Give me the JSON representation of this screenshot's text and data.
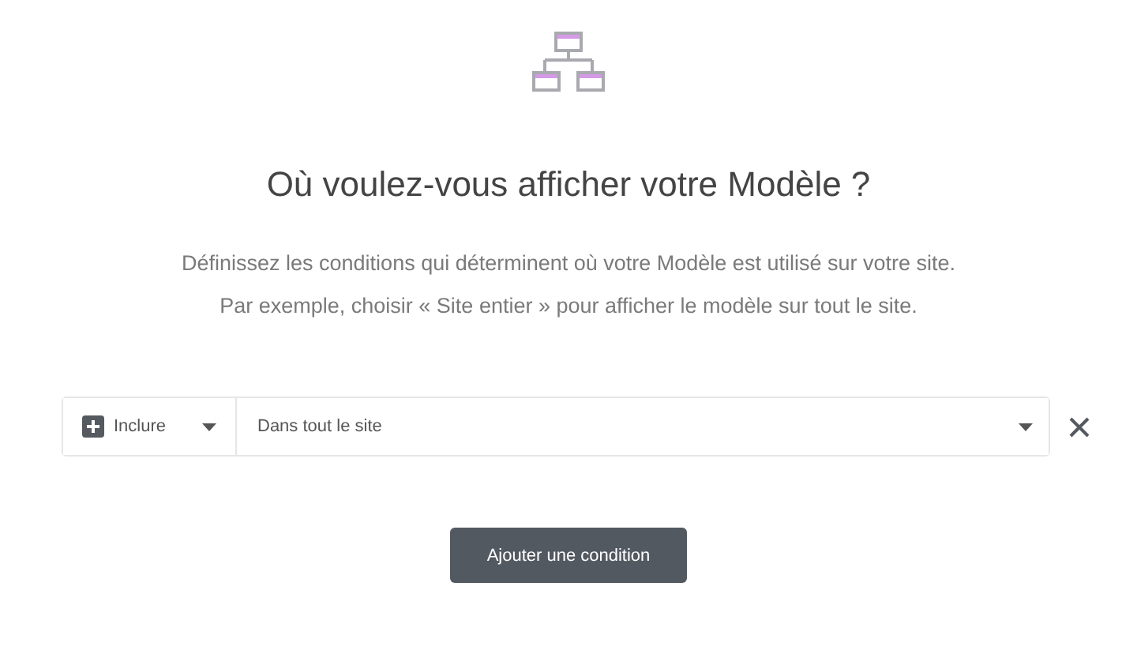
{
  "title": "Où voulez-vous afficher votre Modèle ?",
  "description": [
    "Définissez les conditions qui déterminent où votre Modèle est utilisé sur votre site.",
    "Par exemple, choisir « Site entier » pour afficher le modèle sur tout le site."
  ],
  "condition": {
    "type": "Inclure",
    "scope": "Dans tout le site"
  },
  "button": "Ajouter une condition"
}
